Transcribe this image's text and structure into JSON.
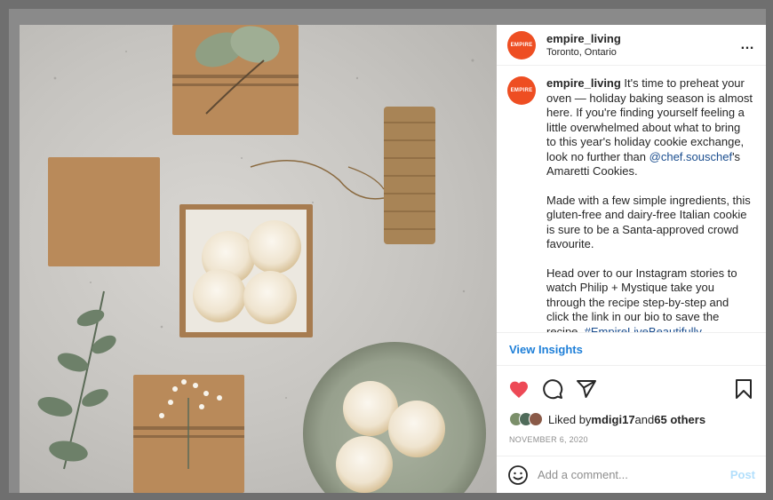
{
  "post": {
    "username": "empire_living",
    "location": "Toronto, Ontario",
    "avatar_text": "EMPIRE",
    "more_icon": "…"
  },
  "caption": {
    "username": "empire_living",
    "p1_text": " It's time to preheat your oven — holiday baking season is almost here. If you're finding yourself feeling a little overwhelmed about what to bring to this year's holiday cookie exchange, look no further than ",
    "p1_mention": "@chef.souschef",
    "p1_end": "'s Amaretti Cookies.",
    "p2": "Made with a few simple ingredients, this gluten-free and dairy-free Italian cookie is sure to be a Santa-approved crowd favourite.",
    "p3_text": "Head over to our Instagram stories to watch Philip + Mystique take you through the recipe step-by-step and click the link in our bio to save the recipe. ",
    "p3_hashtag": "#EmpireLiveBeautifully"
  },
  "insights_label": "View Insights",
  "likes": {
    "prefix": "Liked by ",
    "user": "mdigi17",
    "middle": " and ",
    "count": "65 others"
  },
  "date": "NOVEMBER 6, 2020",
  "comment": {
    "placeholder": "Add a comment...",
    "post_label": "Post"
  },
  "colors": {
    "brand": "#ee4e22",
    "link": "#1b4e8f",
    "insights": "#1e7fd8",
    "heart": "#ed4956",
    "post_disabled": "#b2dffc"
  }
}
